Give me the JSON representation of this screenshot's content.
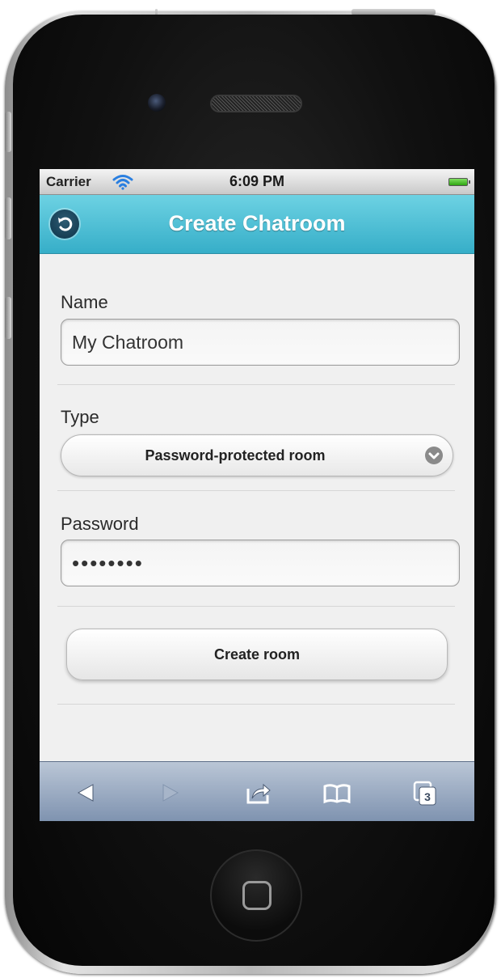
{
  "status_bar": {
    "carrier": "Carrier",
    "time": "6:09 PM",
    "icons": [
      "wifi-icon",
      "battery-icon"
    ]
  },
  "header": {
    "title": "Create Chatroom",
    "back_icon": "back-arrow-icon",
    "accent_color": "#3fb8cf"
  },
  "form": {
    "name_label": "Name",
    "name_value": "My Chatroom",
    "type_label": "Type",
    "type_value": "Password-protected room",
    "password_label": "Password",
    "password_value": "12345678",
    "submit_label": "Create room"
  },
  "browser_toolbar": {
    "items": [
      "back-icon",
      "forward-icon",
      "share-icon",
      "bookmarks-icon",
      "tabs-icon"
    ],
    "tabs_count": "3"
  }
}
